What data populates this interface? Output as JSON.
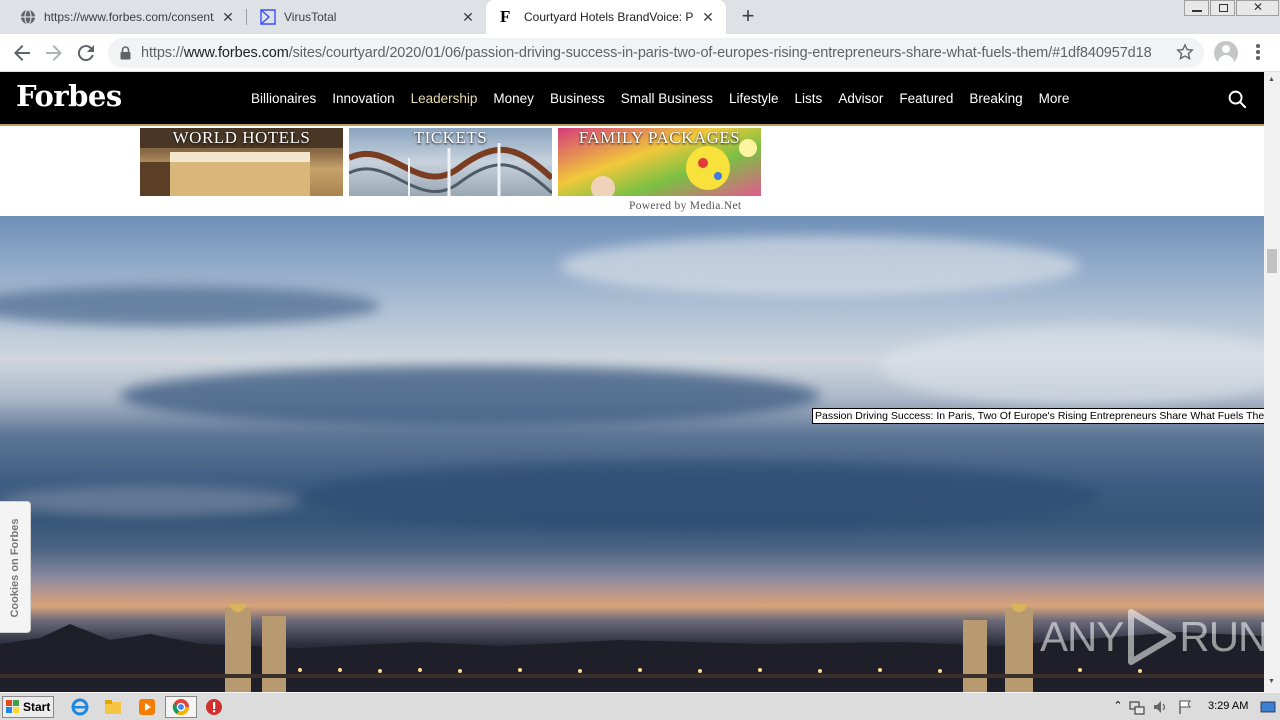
{
  "browser": {
    "tabs": [
      {
        "title": "https://www.forbes.com/consent/?to",
        "favicon": "globe-icon",
        "active": false
      },
      {
        "title": "VirusTotal",
        "favicon": "virustotal-icon",
        "active": false
      },
      {
        "title": "Courtyard Hotels BrandVoice: Passio",
        "favicon": "forbes-f-icon",
        "active": true
      }
    ],
    "url_prefix": "https://",
    "url_host": "www.forbes.com",
    "url_path": "/sites/courtyard/2020/01/06/passion-driving-success-in-paris-two-of-europes-rising-entrepreneurs-share-what-fuels-them/#1df840957d18"
  },
  "site": {
    "logo": "Forbes",
    "nav": [
      "Billionaires",
      "Innovation",
      "Leadership",
      "Money",
      "Business",
      "Small Business",
      "Lifestyle",
      "Lists",
      "Advisor",
      "Featured",
      "Breaking",
      "More"
    ],
    "active_nav": "Leadership"
  },
  "ads": [
    {
      "title": "WORLD HOTELS"
    },
    {
      "title": "TICKETS"
    },
    {
      "title": "FAMILY PACKAGES"
    }
  ],
  "powered_by": "Powered by Media.Net",
  "tooltip": "Passion Driving Success: In Paris, Two Of Europe's Rising Entrepreneurs Share What Fuels Them",
  "cookies_tab": "Cookies on Forbes",
  "watermark": {
    "left": "ANY",
    "right": "RUN"
  },
  "taskbar": {
    "start_label": "Start",
    "clock": "3:29 AM"
  },
  "colors": {
    "forbes_header": "#000000",
    "forbes_accent": "#b8a160",
    "chrome_tabstrip": "#dee1e6"
  }
}
